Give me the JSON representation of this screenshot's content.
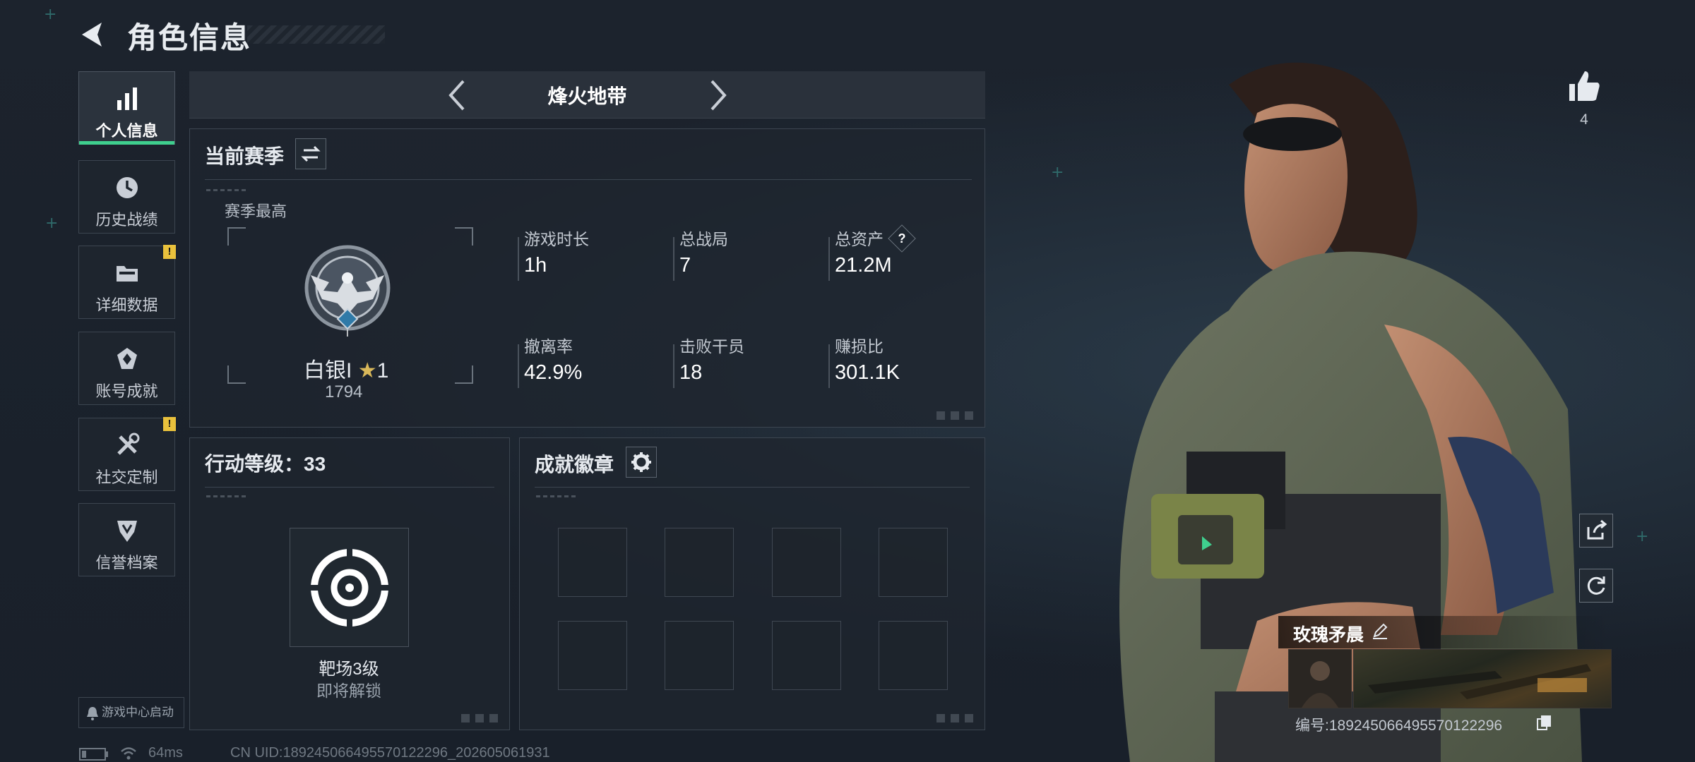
{
  "header": {
    "title": "角色信息"
  },
  "nav": [
    {
      "label": "个人信息",
      "icon": "bar-chart-icon",
      "active": true
    },
    {
      "label": "历史战绩",
      "icon": "history-clock-icon"
    },
    {
      "label": "详细数据",
      "icon": "folder-icon",
      "alert": "!"
    },
    {
      "label": "账号成就",
      "icon": "achievement-icon"
    },
    {
      "label": "社交定制",
      "icon": "tools-icon",
      "alert": "!"
    },
    {
      "label": "信誉档案",
      "icon": "credibility-icon"
    }
  ],
  "game_center": "游戏中心启动",
  "mode": {
    "title": "烽火地带"
  },
  "season": {
    "title": "当前赛季",
    "best_label": "赛季最高",
    "rank_name": "白银I",
    "rank_star": "1",
    "rank_score": "1794",
    "rank_tier": "I",
    "stats": [
      {
        "label": "游戏时长",
        "value": "1h"
      },
      {
        "label": "总战局",
        "value": "7"
      },
      {
        "label": "总资产",
        "value": "21.2M",
        "help": "?"
      },
      {
        "label": "撤离率",
        "value": "42.9%"
      },
      {
        "label": "击败干员",
        "value": "18"
      },
      {
        "label": "赚损比",
        "value": "301.1K"
      }
    ]
  },
  "action_level": {
    "title": "行动等级：33",
    "target_name": "靶场3级",
    "target_sub": "即将解锁"
  },
  "badges": {
    "title": "成就徽章",
    "slots": 8
  },
  "status_bar": {
    "ping": "64ms",
    "uid": "CN UID:18924506649557012229​6_202605061931"
  },
  "character": {
    "likes": "4",
    "name": "玫瑰矛晨",
    "serial": "编号:18924506649557012229​6"
  },
  "colors": {
    "accent": "#3fcf8e",
    "alert": "#e9c13c",
    "bg": "#1a212b"
  }
}
